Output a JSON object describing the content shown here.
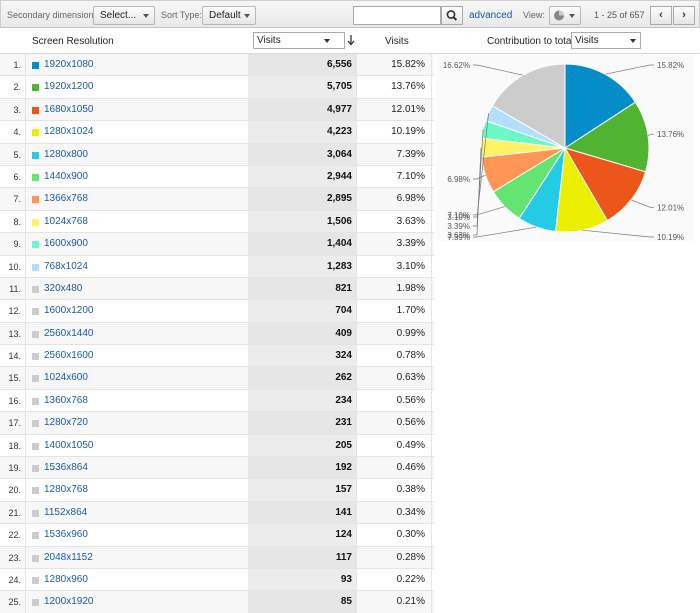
{
  "toolbar": {
    "secondary_dimension_label": "Secondary dimension:",
    "secondary_dimension_value": "Select...",
    "sort_type_label": "Sort Type:",
    "sort_type_value": "Default",
    "search_value": "",
    "advanced_label": "advanced",
    "view_label": "View:",
    "pagination": "1 - 25 of 657",
    "prev_label": "‹",
    "next_label": "›"
  },
  "table": {
    "col_dimension": "Screen Resolution",
    "col_metric_select": "Visits",
    "col_visits_pct": "Visits",
    "contribution_label": "Contribution to total:",
    "contribution_select": "Visits",
    "rows": [
      {
        "idx": "1.",
        "name": "1920x1080",
        "visits": "6,556",
        "pct": "15.82%",
        "color": "#058dc7"
      },
      {
        "idx": "2.",
        "name": "1920x1200",
        "visits": "5,705",
        "pct": "13.76%",
        "color": "#50b432"
      },
      {
        "idx": "3.",
        "name": "1680x1050",
        "visits": "4,977",
        "pct": "12.01%",
        "color": "#ed561b"
      },
      {
        "idx": "4.",
        "name": "1280x1024",
        "visits": "4,223",
        "pct": "10.19%",
        "color": "#edef00"
      },
      {
        "idx": "5.",
        "name": "1280x800",
        "visits": "3,064",
        "pct": "7.39%",
        "color": "#24cbe5"
      },
      {
        "idx": "6.",
        "name": "1440x900",
        "visits": "2,944",
        "pct": "7.10%",
        "color": "#64e572"
      },
      {
        "idx": "7.",
        "name": "1366x768",
        "visits": "2,895",
        "pct": "6.98%",
        "color": "#ff9655"
      },
      {
        "idx": "8.",
        "name": "1024x768",
        "visits": "1,506",
        "pct": "3.63%",
        "color": "#fff263"
      },
      {
        "idx": "9.",
        "name": "1600x900",
        "visits": "1,404",
        "pct": "3.39%",
        "color": "#6af9c4"
      },
      {
        "idx": "10.",
        "name": "768x1024",
        "visits": "1,283",
        "pct": "3.10%",
        "color": "#b2deff"
      },
      {
        "idx": "11.",
        "name": "320x480",
        "visits": "821",
        "pct": "1.98%",
        "color": "#cccccc"
      },
      {
        "idx": "12.",
        "name": "1600x1200",
        "visits": "704",
        "pct": "1.70%",
        "color": "#cccccc"
      },
      {
        "idx": "13.",
        "name": "2560x1440",
        "visits": "409",
        "pct": "0.99%",
        "color": "#cccccc"
      },
      {
        "idx": "14.",
        "name": "2560x1600",
        "visits": "324",
        "pct": "0.78%",
        "color": "#cccccc"
      },
      {
        "idx": "15.",
        "name": "1024x600",
        "visits": "262",
        "pct": "0.63%",
        "color": "#cccccc"
      },
      {
        "idx": "16.",
        "name": "1360x768",
        "visits": "234",
        "pct": "0.56%",
        "color": "#cccccc"
      },
      {
        "idx": "17.",
        "name": "1280x720",
        "visits": "231",
        "pct": "0.56%",
        "color": "#cccccc"
      },
      {
        "idx": "18.",
        "name": "1400x1050",
        "visits": "205",
        "pct": "0.49%",
        "color": "#cccccc"
      },
      {
        "idx": "19.",
        "name": "1536x864",
        "visits": "192",
        "pct": "0.46%",
        "color": "#cccccc"
      },
      {
        "idx": "20.",
        "name": "1280x768",
        "visits": "157",
        "pct": "0.38%",
        "color": "#cccccc"
      },
      {
        "idx": "21.",
        "name": "1152x864",
        "visits": "141",
        "pct": "0.34%",
        "color": "#cccccc"
      },
      {
        "idx": "22.",
        "name": "1536x960",
        "visits": "124",
        "pct": "0.30%",
        "color": "#cccccc"
      },
      {
        "idx": "23.",
        "name": "2048x1152",
        "visits": "117",
        "pct": "0.28%",
        "color": "#cccccc"
      },
      {
        "idx": "24.",
        "name": "1280x960",
        "visits": "93",
        "pct": "0.22%",
        "color": "#cccccc"
      },
      {
        "idx": "25.",
        "name": "1200x1920",
        "visits": "85",
        "pct": "0.21%",
        "color": "#cccccc"
      }
    ]
  },
  "chart_data": {
    "type": "pie",
    "slices": [
      {
        "label": "15.82%",
        "value": 15.82,
        "color": "#058dc7"
      },
      {
        "label": "13.76%",
        "value": 13.76,
        "color": "#50b432"
      },
      {
        "label": "12.01%",
        "value": 12.01,
        "color": "#ed561b"
      },
      {
        "label": "10.19%",
        "value": 10.19,
        "color": "#edef00"
      },
      {
        "label": "7.39%",
        "value": 7.39,
        "color": "#24cbe5"
      },
      {
        "label": "7.10%",
        "value": 7.1,
        "color": "#64e572"
      },
      {
        "label": "6.98%",
        "value": 6.98,
        "color": "#ff9655"
      },
      {
        "label": "3.63%",
        "value": 3.63,
        "color": "#fff263"
      },
      {
        "label": "3.39%",
        "value": 3.39,
        "color": "#6af9c4"
      },
      {
        "label": "3.10%",
        "value": 3.1,
        "color": "#b2deff"
      },
      {
        "label": "16.62%",
        "value": 16.62,
        "color": "#cccccc"
      }
    ]
  }
}
